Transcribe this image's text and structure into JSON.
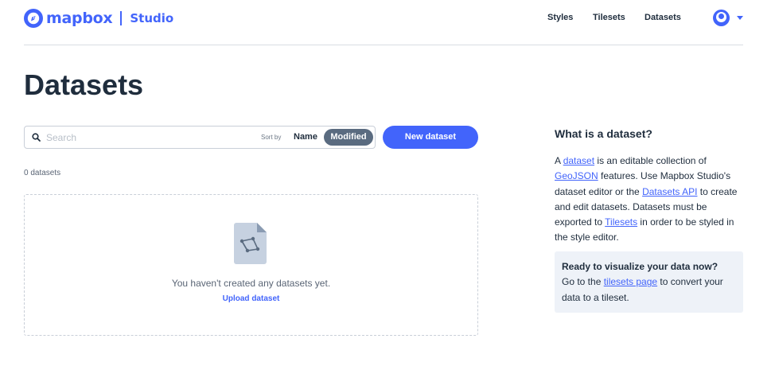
{
  "header": {
    "logo_word": "mapbox",
    "logo_product": "Studio",
    "nav": [
      "Styles",
      "Tilesets",
      "Datasets"
    ]
  },
  "page": {
    "title": "Datasets"
  },
  "toolbar": {
    "search_placeholder": "Search",
    "sort_label": "Sort by",
    "sort_options": [
      "Name",
      "Modified"
    ],
    "sort_selected": "Modified",
    "new_button": "New dataset"
  },
  "list": {
    "count_text": "0 datasets",
    "empty_message": "You haven't created any datasets yet.",
    "upload_link": "Upload dataset"
  },
  "sidebar": {
    "title": "What is a dataset?",
    "p1": "A ",
    "link_dataset": "dataset",
    "p2": " is an editable collection of ",
    "link_geojson": "GeoJSON",
    "p3": " features. Use Mapbox Studio's dataset editor or the ",
    "link_api": "Datasets API",
    "p4": " to create and edit datasets. Datasets must be exported to ",
    "link_tilesets": "Tilesets",
    "p5": " in order to be styled in the style editor.",
    "callout_title": "Ready to visualize your data now?",
    "callout_p1": "Go to the ",
    "callout_link": "tilesets page",
    "callout_p2": " to convert your data to a tileset."
  },
  "colors": {
    "brand": "#4264fb",
    "text": "#1f2d3d",
    "muted": "#5a6575"
  },
  "icons": [
    "mapbox-logo-icon",
    "avatar-icon",
    "caret-down-icon",
    "search-icon",
    "dataset-file-icon"
  ]
}
